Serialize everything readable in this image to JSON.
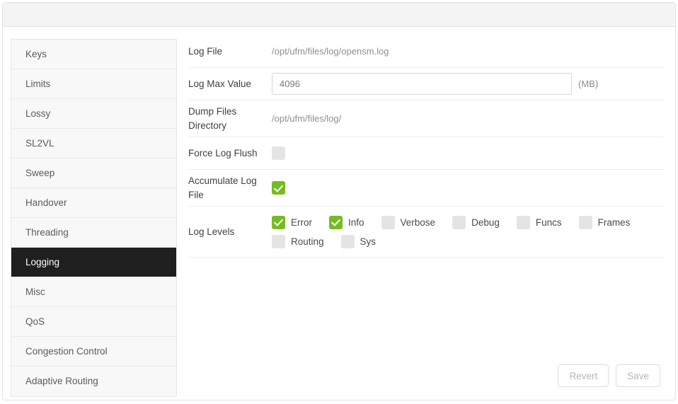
{
  "header": {
    "title": ""
  },
  "sidebar": {
    "items": [
      {
        "label": "Keys",
        "active": false
      },
      {
        "label": "Limits",
        "active": false
      },
      {
        "label": "Lossy",
        "active": false
      },
      {
        "label": "SL2VL",
        "active": false
      },
      {
        "label": "Sweep",
        "active": false
      },
      {
        "label": "Handover",
        "active": false
      },
      {
        "label": "Threading",
        "active": false
      },
      {
        "label": "Logging",
        "active": true
      },
      {
        "label": "Misc",
        "active": false
      },
      {
        "label": "QoS",
        "active": false
      },
      {
        "label": "Congestion Control",
        "active": false
      },
      {
        "label": "Adaptive Routing",
        "active": false
      }
    ]
  },
  "form": {
    "log_file": {
      "label": "Log File",
      "value": "/opt/ufm/files/log/opensm.log"
    },
    "log_max_value": {
      "label": "Log Max Value",
      "value": "4096",
      "placeholder": "",
      "unit": "(MB)"
    },
    "dump_files_directory": {
      "label": "Dump Files Directory",
      "value": "/opt/ufm/files/log/"
    },
    "force_log_flush": {
      "label": "Force Log Flush",
      "checked": false
    },
    "accumulate_log_file": {
      "label": "Accumulate Log File",
      "checked": true
    },
    "log_levels": {
      "label": "Log Levels",
      "options": [
        {
          "label": "Error",
          "checked": true
        },
        {
          "label": "Info",
          "checked": true
        },
        {
          "label": "Verbose",
          "checked": false
        },
        {
          "label": "Debug",
          "checked": false
        },
        {
          "label": "Funcs",
          "checked": false
        },
        {
          "label": "Frames",
          "checked": false
        },
        {
          "label": "Routing",
          "checked": false
        },
        {
          "label": "Sys",
          "checked": false
        }
      ]
    }
  },
  "footer": {
    "revert_label": "Revert",
    "save_label": "Save"
  },
  "colors": {
    "checkbox_checked": "#76bc21",
    "checkbox_unchecked": "#e4e4e4",
    "active_sidebar_bg": "#1f1f1f"
  }
}
